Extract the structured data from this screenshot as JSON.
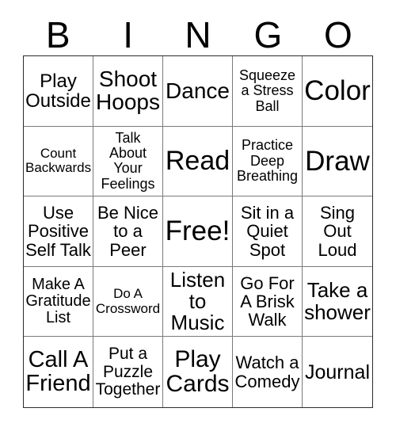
{
  "card": {
    "title_letters": [
      "B",
      "I",
      "N",
      "G",
      "O"
    ],
    "colors": {
      "background": "#ffffff",
      "text": "#000000",
      "outer_border": "#2b2b2b",
      "inner_border": "#7a7a7a"
    },
    "grid_size": "5x5",
    "rows": [
      [
        {
          "label": "Play Outside",
          "size": "lg"
        },
        {
          "label": "Shoot Hoops",
          "size": "xl"
        },
        {
          "label": "Dance",
          "size": "xxl"
        },
        {
          "label": "Squeeze a Stress Ball",
          "size": "sm"
        },
        {
          "label": "Color",
          "size": "xxl"
        }
      ],
      [
        {
          "label": "Count Backwards",
          "size": "sm"
        },
        {
          "label": "Talk About Your Feelings",
          "size": "sm"
        },
        {
          "label": "Read",
          "size": "xxl"
        },
        {
          "label": "Practice Deep Breathing",
          "size": "sm"
        },
        {
          "label": "Draw",
          "size": "xxl"
        }
      ],
      [
        {
          "label": "Use Positive Self Talk",
          "size": "md"
        },
        {
          "label": "Be Nice to a Peer",
          "size": "md"
        },
        {
          "label": "Free!",
          "size": "xxl"
        },
        {
          "label": "Sit in a Quiet Spot",
          "size": "md"
        },
        {
          "label": "Sing Out Loud",
          "size": "md"
        }
      ],
      [
        {
          "label": "Make A Gratitude List",
          "size": "md"
        },
        {
          "label": "Do A Crossword",
          "size": "sm"
        },
        {
          "label": "Listen to Music",
          "size": "lg"
        },
        {
          "label": "Go For A Brisk Walk",
          "size": "md"
        },
        {
          "label": "Take a shower",
          "size": "lg"
        }
      ],
      [
        {
          "label": "Call A Friend",
          "size": "xl"
        },
        {
          "label": "Put a Puzzle Together",
          "size": "md"
        },
        {
          "label": "Play Cards",
          "size": "xl"
        },
        {
          "label": "Watch a Comedy",
          "size": "md"
        },
        {
          "label": "Journal",
          "size": "lg"
        }
      ]
    ]
  }
}
